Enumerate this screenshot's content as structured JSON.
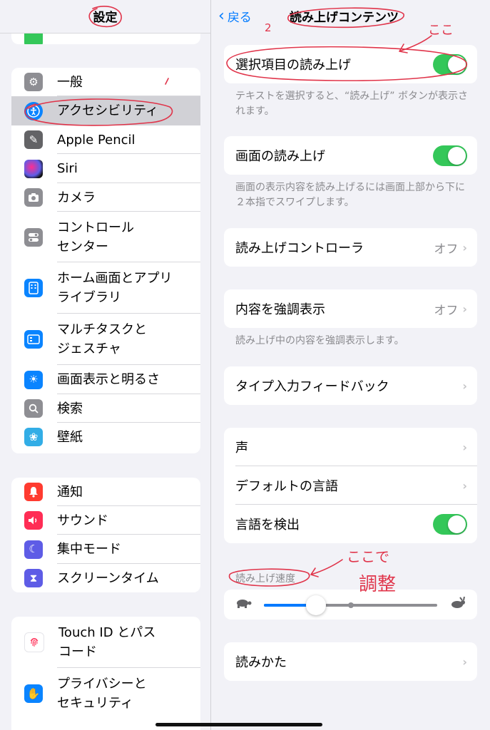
{
  "sidebar": {
    "title": "設定",
    "groups": [
      {
        "items": [
          {
            "label": "一般",
            "icon": "gear-icon"
          },
          {
            "label": "アクセシビリティ",
            "icon": "accessibility-icon",
            "selected": true
          },
          {
            "label": "Apple Pencil",
            "icon": "pencil-icon"
          },
          {
            "label": "Siri",
            "icon": "siri-icon"
          },
          {
            "label": "カメラ",
            "icon": "camera-icon"
          },
          {
            "label": "コントロール\nセンター",
            "icon": "control-center-icon"
          },
          {
            "label": "ホーム画面とアプリ\nライブラリ",
            "icon": "home-screen-icon"
          },
          {
            "label": "マルチタスクと\nジェスチャ",
            "icon": "multitasking-icon"
          },
          {
            "label": "画面表示と明るさ",
            "icon": "brightness-icon"
          },
          {
            "label": "検索",
            "icon": "search-icon"
          },
          {
            "label": "壁紙",
            "icon": "wallpaper-icon"
          }
        ]
      },
      {
        "items": [
          {
            "label": "通知",
            "icon": "notification-icon"
          },
          {
            "label": "サウンド",
            "icon": "sound-icon"
          },
          {
            "label": "集中モード",
            "icon": "moon-icon"
          },
          {
            "label": "スクリーンタイム",
            "icon": "hourglass-icon"
          }
        ]
      },
      {
        "items": [
          {
            "label": "Touch ID とパス\nコード",
            "icon": "fingerprint-icon"
          },
          {
            "label": "プライバシーと\nセキュリティ",
            "icon": "hand-icon"
          }
        ]
      }
    ]
  },
  "detail": {
    "back_label": "戻る",
    "title": "読み上げコンテンツ",
    "speak_selection": {
      "label": "選択項目の読み上げ",
      "on": true
    },
    "speak_selection_footer": "テキストを選択すると、“読み上げ” ボタンが表示されます。",
    "speak_screen": {
      "label": "画面の読み上げ",
      "on": true
    },
    "speak_screen_footer": "画面の表示内容を読み上げるには画面上部から下に２本指でスワイプします。",
    "speech_controller": {
      "label": "読み上げコントローラ",
      "value": "オフ"
    },
    "highlight_content": {
      "label": "内容を強調表示",
      "value": "オフ"
    },
    "highlight_footer": "読み上げ中の内容を強調表示します。",
    "typing_feedback": {
      "label": "タイプ入力フィードバック"
    },
    "voices": {
      "label": "声"
    },
    "default_language": {
      "label": "デフォルトの言語"
    },
    "detect_language": {
      "label": "言語を検出",
      "on": true
    },
    "speaking_rate": {
      "header": "読み上げ速度",
      "value_fraction": 0.3,
      "ticks": [
        0.5
      ]
    },
    "pronunciations": {
      "label": "読みかた"
    }
  },
  "annotations": {
    "mark_1": "1",
    "mark_2": "2",
    "here": "ここ",
    "adjust_line1": "ここで",
    "adjust_line2": "調整"
  },
  "colors": {
    "accent": "#007aff",
    "toggle_on": "#34c759",
    "annotation": "#e0344a"
  }
}
